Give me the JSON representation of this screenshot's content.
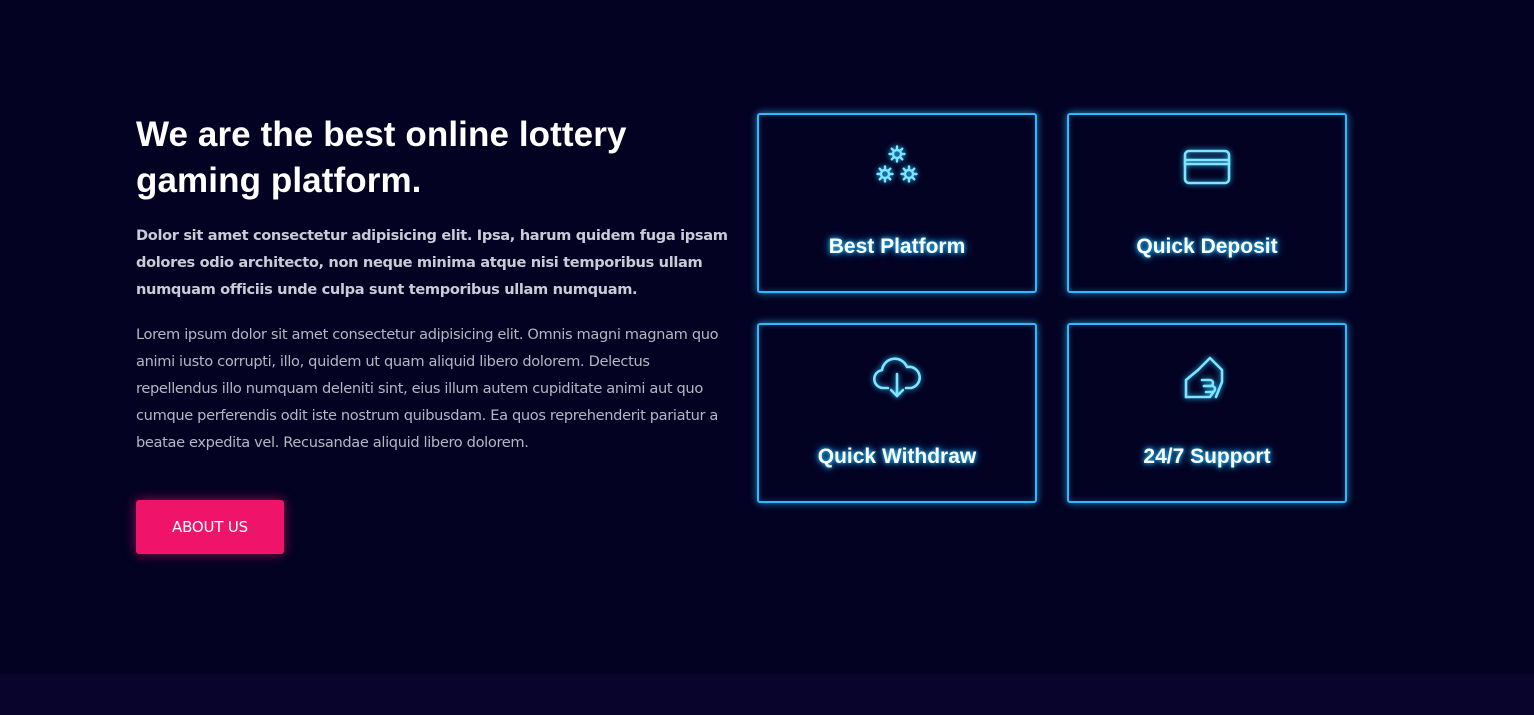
{
  "about": {
    "heading": "We are the best online lottery gaming platform.",
    "paragraph_1": "Dolor sit amet consectetur adipisicing elit. Ipsa, harum quidem fuga ipsam dolores odio architecto, non neque minima atque nisi temporibus ullam numquam officiis unde culpa sunt temporibus ullam numquam.",
    "paragraph_2": "Lorem ipsum dolor sit amet consectetur adipisicing elit. Omnis magni magnam quo animi iusto corrupti, illo, quidem ut quam aliquid libero dolorem. Delectus repellendus illo numquam deleniti sint, eius illum autem cupiditate animi aut quo cumque perferendis odit iste nostrum quibusdam. Ea quos reprehenderit pariatur a beatae expedita vel. Recusandae aliquid libero dolorem.",
    "button_label": "ABOUT US"
  },
  "features": [
    {
      "label": "Best Platform",
      "icon": "gears-icon"
    },
    {
      "label": "Quick Deposit",
      "icon": "credit-card-icon"
    },
    {
      "label": "Quick Withdraw",
      "icon": "cloud-download-icon"
    },
    {
      "label": "24/7 Support",
      "icon": "hand-house-icon"
    }
  ],
  "colors": {
    "background": "#030222",
    "bottom_band": "#08042c",
    "accent_pink": "#ef1469",
    "neon_blue": "#2fb9ff",
    "icon_cyan": "#7fe4ff"
  }
}
